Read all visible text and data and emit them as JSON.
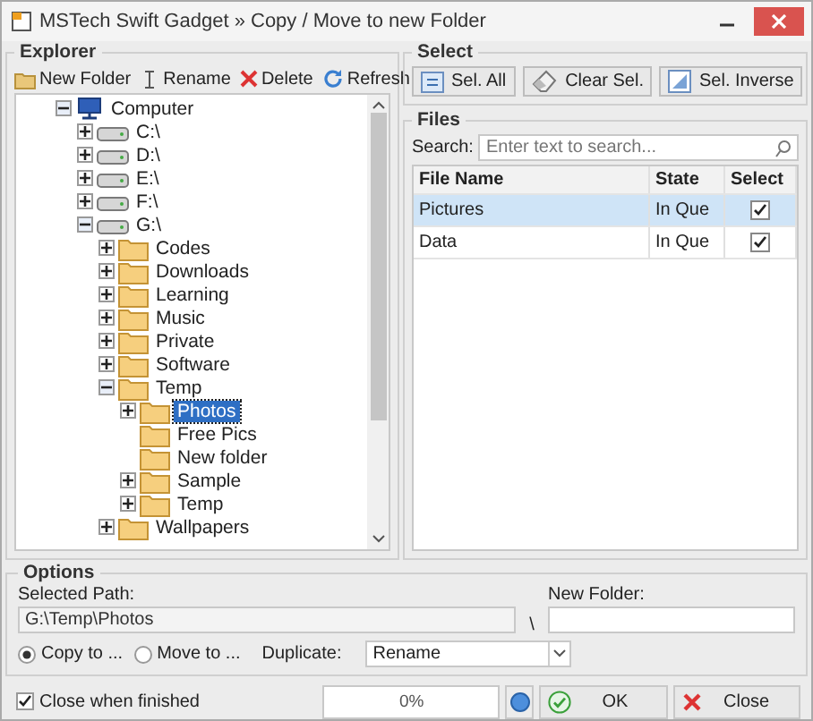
{
  "window": {
    "title": "MSTech Swift Gadget » Copy / Move to new Folder"
  },
  "explorer": {
    "title": "Explorer",
    "toolbar": [
      {
        "label": "New Folder",
        "kind": "new-folder"
      },
      {
        "label": "Rename",
        "kind": "rename"
      },
      {
        "label": "Delete",
        "kind": "delete"
      },
      {
        "label": "Refresh",
        "kind": "refresh"
      }
    ],
    "tree": [
      {
        "label": "Computer",
        "kind": "computer",
        "expandable": true,
        "expanded": true,
        "selected": false,
        "children": [
          {
            "label": "C:\\",
            "kind": "drive",
            "expandable": true,
            "expanded": false,
            "selected": false
          },
          {
            "label": "D:\\",
            "kind": "drive",
            "expandable": true,
            "expanded": false,
            "selected": false
          },
          {
            "label": "E:\\",
            "kind": "drive",
            "expandable": true,
            "expanded": false,
            "selected": false
          },
          {
            "label": "F:\\",
            "kind": "drive",
            "expandable": true,
            "expanded": false,
            "selected": false
          },
          {
            "label": "G:\\",
            "kind": "drive",
            "expandable": true,
            "expanded": true,
            "selected": false,
            "children": [
              {
                "label": "Codes",
                "kind": "folder",
                "expandable": true,
                "expanded": false,
                "selected": false
              },
              {
                "label": "Downloads",
                "kind": "folder",
                "expandable": true,
                "expanded": false,
                "selected": false
              },
              {
                "label": "Learning",
                "kind": "folder",
                "expandable": true,
                "expanded": false,
                "selected": false
              },
              {
                "label": "Music",
                "kind": "folder",
                "expandable": true,
                "expanded": false,
                "selected": false
              },
              {
                "label": "Private",
                "kind": "folder",
                "expandable": true,
                "expanded": false,
                "selected": false
              },
              {
                "label": "Software",
                "kind": "folder",
                "expandable": true,
                "expanded": false,
                "selected": false
              },
              {
                "label": "Temp",
                "kind": "folder",
                "expandable": true,
                "expanded": true,
                "selected": false,
                "children": [
                  {
                    "label": "Photos",
                    "kind": "folder",
                    "expandable": true,
                    "expanded": false,
                    "selected": true
                  },
                  {
                    "label": "Free Pics",
                    "kind": "folder",
                    "expandable": false,
                    "expanded": false,
                    "selected": false
                  },
                  {
                    "label": "New folder",
                    "kind": "folder",
                    "expandable": false,
                    "expanded": false,
                    "selected": false
                  },
                  {
                    "label": "Sample",
                    "kind": "folder",
                    "expandable": true,
                    "expanded": false,
                    "selected": false
                  },
                  {
                    "label": "Temp",
                    "kind": "folder",
                    "expandable": true,
                    "expanded": false,
                    "selected": false
                  }
                ]
              },
              {
                "label": "Wallpapers",
                "kind": "folder",
                "expandable": true,
                "expanded": false,
                "selected": false
              }
            ]
          }
        ]
      }
    ]
  },
  "select": {
    "title": "Select",
    "buttons": [
      {
        "label": "Sel. All",
        "kind": "select-all"
      },
      {
        "label": "Clear Sel.",
        "kind": "clear"
      },
      {
        "label": "Sel. Inverse",
        "kind": "inverse"
      }
    ]
  },
  "files": {
    "title": "Files",
    "search_label": "Search:",
    "search": {
      "placeholder": "Enter text to search..."
    },
    "columns": [
      "File Name",
      "State",
      "Select"
    ],
    "rows": [
      {
        "name": "Pictures",
        "state": "In Que",
        "checked": true,
        "selected": true
      },
      {
        "name": "Data",
        "state": "In Que",
        "checked": true,
        "selected": false
      }
    ]
  },
  "options": {
    "title": "Options",
    "selected_path_label": "Selected Path:",
    "selected_path": "G:\\Temp\\Photos",
    "separator": "\\",
    "new_folder_label": "New Folder:",
    "modes": [
      {
        "label": "Copy to ...",
        "selected": true
      },
      {
        "label": "Move to ...",
        "selected": false
      }
    ],
    "duplicate_label": "Duplicate:",
    "duplicate": "Rename",
    "close_when_finished": {
      "label": "Close when finished",
      "checked": true
    },
    "progress": {
      "level": 0,
      "reading": "0%"
    },
    "buttons": [
      {
        "label": "OK",
        "kind": "ok"
      },
      {
        "label": "Close",
        "kind": "close"
      }
    ]
  }
}
